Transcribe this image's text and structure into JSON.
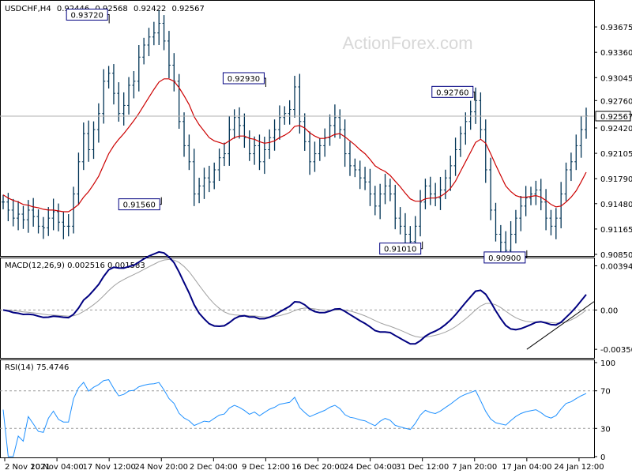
{
  "chart_data": {
    "type": "ohlc",
    "header": {
      "symbol": "USDCHF,H4",
      "open": "0.92446",
      "high": "0.92568",
      "low": "0.92422",
      "close": "0.92567"
    },
    "watermark": "ActionForex.com",
    "x_ticks": [
      "2 Nov 2021",
      "10 Nov 04:00",
      "17 Nov 12:00",
      "24 Nov 20:00",
      "2 Dec 04:00",
      "9 Dec 12:00",
      "16 Dec 20:00",
      "24 Dec 04:00",
      "31 Dec 12:00",
      "7 Jan 20:00",
      "17 Jan 04:00",
      "24 Jan 12:00"
    ],
    "price": {
      "ylim": [
        0.9085,
        0.9397
      ],
      "y_ticks": [
        "0.93675",
        "0.93360",
        "0.93045",
        "0.92760",
        "0.92420",
        "0.92105",
        "0.91790",
        "0.91480",
        "0.91165",
        "0.90850"
      ],
      "current_price": "0.92567",
      "ma_color": "#cc0000",
      "bar_color": "#003355",
      "annotations": [
        {
          "text": "0.93720",
          "x": "17 Nov 12:00",
          "y": 0.9372
        },
        {
          "text": "0.92930",
          "x": "9 Dec 12:00",
          "y": 0.9293
        },
        {
          "text": "0.91560",
          "x": "24 Nov 20:00",
          "y": 0.9156
        },
        {
          "text": "0.91010",
          "x": "31 Dec 12:00",
          "y": 0.9101
        },
        {
          "text": "0.92760",
          "x": "7 Jan 20:00",
          "y": 0.9276
        },
        {
          "text": "0.90900",
          "x": "17 Jan 04:00",
          "y": 0.909
        }
      ],
      "close_series": [
        0.915,
        0.914,
        0.913,
        0.9135,
        0.9128,
        0.914,
        0.9132,
        0.912,
        0.9118,
        0.913,
        0.9138,
        0.9125,
        0.912,
        0.912,
        0.916,
        0.92,
        0.9235,
        0.9215,
        0.924,
        0.926,
        0.93,
        0.931,
        0.9285,
        0.926,
        0.927,
        0.9295,
        0.93,
        0.933,
        0.9345,
        0.9355,
        0.936,
        0.9372,
        0.935,
        0.932,
        0.93,
        0.925,
        0.922,
        0.92,
        0.916,
        0.917,
        0.918,
        0.9175,
        0.919,
        0.9205,
        0.921,
        0.924,
        0.9255,
        0.9245,
        0.923,
        0.921,
        0.922,
        0.92,
        0.9215,
        0.923,
        0.924,
        0.9255,
        0.926,
        0.9265,
        0.9293,
        0.925,
        0.9225,
        0.92,
        0.921,
        0.922,
        0.923,
        0.9245,
        0.9255,
        0.924,
        0.921,
        0.9195,
        0.919,
        0.918,
        0.9175,
        0.916,
        0.9145,
        0.916,
        0.917,
        0.916,
        0.913,
        0.912,
        0.911,
        0.9101,
        0.912,
        0.915,
        0.917,
        0.916,
        0.9155,
        0.9165,
        0.918,
        0.9195,
        0.9215,
        0.9235,
        0.925,
        0.9262,
        0.9276,
        0.924,
        0.919,
        0.914,
        0.911,
        0.91,
        0.909,
        0.911,
        0.913,
        0.9145,
        0.9155,
        0.916,
        0.9165,
        0.915,
        0.913,
        0.912,
        0.913,
        0.916,
        0.919,
        0.92,
        0.922,
        0.924,
        0.9257
      ],
      "ma_series": [
        0.9159,
        0.9155,
        0.9152,
        0.915,
        0.9147,
        0.9146,
        0.9144,
        0.9143,
        0.9141,
        0.914,
        0.914,
        0.9139,
        0.9138,
        0.9138,
        0.9142,
        0.9147,
        0.9156,
        0.9163,
        0.9172,
        0.9182,
        0.9196,
        0.921,
        0.922,
        0.9228,
        0.9235,
        0.9243,
        0.9251,
        0.926,
        0.927,
        0.928,
        0.929,
        0.9299,
        0.9303,
        0.9303,
        0.93,
        0.9292,
        0.9282,
        0.9271,
        0.9256,
        0.9246,
        0.9238,
        0.923,
        0.9226,
        0.9224,
        0.9222,
        0.9226,
        0.923,
        0.9232,
        0.9232,
        0.9229,
        0.9228,
        0.9225,
        0.9223,
        0.9224,
        0.9226,
        0.923,
        0.9233,
        0.9237,
        0.9244,
        0.9245,
        0.9242,
        0.9236,
        0.9232,
        0.9229,
        0.9229,
        0.9231,
        0.9234,
        0.9235,
        0.9231,
        0.9226,
        0.9221,
        0.9215,
        0.921,
        0.9203,
        0.9195,
        0.9191,
        0.9188,
        0.9183,
        0.9176,
        0.9169,
        0.9161,
        0.9154,
        0.9151,
        0.9151,
        0.9154,
        0.9155,
        0.9155,
        0.9157,
        0.9161,
        0.9167,
        0.9176,
        0.9188,
        0.92,
        0.9212,
        0.9224,
        0.9228,
        0.9223,
        0.921,
        0.9196,
        0.9183,
        0.917,
        0.9163,
        0.9158,
        0.9156,
        0.9156,
        0.9157,
        0.9158,
        0.9156,
        0.9152,
        0.9147,
        0.9144,
        0.9145,
        0.915,
        0.9156,
        0.9164,
        0.9175,
        0.9187
      ]
    },
    "macd": {
      "title": "MACD(12,26,9) 0.002516 0.001583",
      "ylim": [
        -0.0042,
        0.0044
      ],
      "y_ticks": [
        {
          "label": "0.003944",
          "value": 0.003944
        },
        {
          "label": "0.00",
          "value": 0.0
        },
        {
          "label": "-0.003506",
          "value": -0.003506
        }
      ],
      "line_color": "#000080",
      "signal_color": "#a0a0a0",
      "trendline": [
        {
          "x": "17 Jan 04:00",
          "y": -0.00351
        },
        {
          "x": "24 Jan 12:00",
          "y": 0.00075
        }
      ]
    },
    "rsi": {
      "title": "RSI(14) 75.4746",
      "ylim": [
        0,
        100
      ],
      "y_ticks": [
        {
          "label": "100",
          "value": 100
        },
        {
          "label": "70",
          "value": 70
        },
        {
          "label": "30",
          "value": 30
        },
        {
          "label": "0",
          "value": 0
        }
      ],
      "line_color": "#1e90ff",
      "levels": [
        70,
        30
      ]
    }
  }
}
